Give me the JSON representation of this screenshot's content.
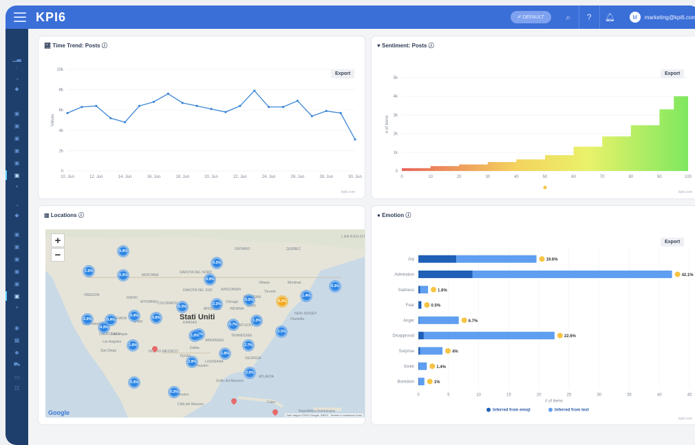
{
  "topbar": {
    "logo": "KPI6",
    "default_label": "DEFAULT",
    "avatar_initial": "M",
    "user_email": "marketing@kpi6.com"
  },
  "sidebar_icons": [
    "chart-icon",
    "filter-icon",
    "pie-icon",
    "tag-icon",
    "panel-icon",
    "panel-icon",
    "panel-icon",
    "panel-icon",
    "panel-icon",
    "panel-icon",
    "plus-icon",
    "pie-icon",
    "tag-icon",
    "panel-icon",
    "panel-icon",
    "panel-icon",
    "panel-icon",
    "panel-icon",
    "panel-icon",
    "plus-icon",
    "globe-icon",
    "calendar-icon",
    "users-icon",
    "cart-icon",
    "card-icon",
    "group-icon"
  ],
  "time_trend": {
    "title": "Time Trend: Posts",
    "export_label": "Export",
    "credit": "kpi6.com",
    "chart_data": {
      "type": "line",
      "ylabel": "Values",
      "ylim": [
        0,
        10000
      ],
      "yticks": [
        "0",
        "2k",
        "4k",
        "6k",
        "8k",
        "10k"
      ],
      "xticks": [
        "10. Jun",
        "12. Jun",
        "14. Jun",
        "16. Jun",
        "18. Jun",
        "20. Jun",
        "22. Jun",
        "24. Jun",
        "26. Jun",
        "28. Jun",
        "30. Jun"
      ],
      "x": [
        "10. Jun",
        "11. Jun",
        "12. Jun",
        "13. Jun",
        "14. Jun",
        "15. Jun",
        "16. Jun",
        "17. Jun",
        "18. Jun",
        "19. Jun",
        "20. Jun",
        "21. Jun",
        "22. Jun",
        "23. Jun",
        "24. Jun",
        "25. Jun",
        "26. Jun",
        "27. Jun",
        "28. Jun",
        "29. Jun",
        "30. Jun"
      ],
      "values": [
        5700,
        6300,
        6400,
        5200,
        4800,
        6400,
        6800,
        7600,
        6700,
        6400,
        6100,
        5800,
        6400,
        7900,
        6300,
        6300,
        6900,
        5400,
        5900,
        5700,
        3100
      ],
      "color": "#3b86d6"
    }
  },
  "sentiment": {
    "title": "Sentiment: Posts",
    "export_label": "Export",
    "credit": "kpi6.com",
    "chart_data": {
      "type": "area",
      "ylabel": "# of items",
      "ylim": [
        0,
        5000
      ],
      "yticks": [
        "0",
        "1k",
        "2k",
        "3k",
        "4k",
        "5k"
      ],
      "xticks": [
        "0",
        "10",
        "20",
        "30",
        "40",
        "50",
        "60",
        "70",
        "80",
        "90",
        "100"
      ],
      "x": [
        0,
        10,
        20,
        30,
        40,
        50,
        60,
        70,
        80,
        90,
        95,
        100
      ],
      "values": [
        150,
        260,
        350,
        480,
        620,
        850,
        1300,
        1850,
        2450,
        3300,
        4000,
        4050
      ]
    }
  },
  "locations": {
    "title": "Locations",
    "google_label": "Google",
    "map_credit": "Dati mappa ©2020 Google, INEGI · Termini e condizioni d'uso",
    "labels": [
      "ONTARIO",
      "QUEBEC",
      "L A B R A D O R",
      "MONTANA",
      "DAKOTA DEL NORD",
      "DAKOTA DEL SUD",
      "IDAHO",
      "WYOMING",
      "OREGON",
      "NEVADA",
      "UTAH",
      "COLORADO",
      "KANSAS",
      "MISSOURI",
      "INDIANA",
      "OHIO",
      "CALIFORNIA",
      "NUOVO MESSICO",
      "TEXAS",
      "LOUISIANA",
      "GEORGIA",
      "TENNESSEE",
      "WISCONSIN",
      "MICHIGAN",
      "ARKANSAS",
      "KENTUCKY",
      "Ottawa",
      "Montreal",
      "Toronto",
      "Chicago",
      "Filadelfia",
      "NEW JERSEY",
      "San Francisco",
      "Las Vegas",
      "Los Angeles",
      "San Diego",
      "Dallas",
      "Houston",
      "Golfo del Messico",
      "Messico",
      "Città del Messico",
      "Cuba",
      "Repubblica Dominicana",
      "Stati Uniti",
      "ATLANTA"
    ],
    "clusters": [
      "0.4%",
      "1.5%",
      "0.3%",
      "0.9%",
      "2.0%",
      "0.4%",
      "0.4%",
      "0.6%",
      "0.3%",
      "2.2%",
      "6.2%",
      "1.4%",
      "0.3%",
      "0.5%",
      "0.7%",
      "1.3%",
      "1.0%",
      "4.3%",
      "1.6%",
      "1.0%",
      "2.7%",
      "1.8%",
      "3.1%",
      "2.9%",
      "2.5%",
      "0.3%",
      "0.3%",
      "0.3%"
    ]
  },
  "emotion": {
    "title": "Emotion",
    "export_label": "Export",
    "credit": "kpi6.com",
    "chart_data": {
      "type": "bar",
      "orientation": "horizontal",
      "categories": [
        "Joy",
        "Admiration",
        "Sadness",
        "Fear",
        "Anger",
        "Disapproval",
        "Surprise",
        "Smirk",
        "Boredom"
      ],
      "series": [
        {
          "name": "Inferred from emoji",
          "color": "#1f5fb5",
          "values": [
            6.3,
            9.0,
            0.3,
            0.5,
            0.1,
            0.9,
            0.3,
            0.1,
            0.1
          ]
        },
        {
          "name": "Inferred from text",
          "color": "#5f9ef0",
          "values": [
            13.3,
            33.1,
            1.3,
            0.0,
            6.6,
            21.7,
            3.7,
            1.3,
            0.9
          ]
        }
      ],
      "data_labels": [
        "19.6%",
        "42.1%",
        "1.6%",
        "0.5%",
        "6.7%",
        "22.6%",
        "4%",
        "1.4%",
        "1%"
      ],
      "xlabel": "# of items",
      "xlim": [
        0,
        45
      ],
      "xticks": [
        "0",
        "5",
        "10",
        "15",
        "20",
        "25",
        "30",
        "35",
        "40",
        "45"
      ],
      "legend": "bottom"
    }
  }
}
